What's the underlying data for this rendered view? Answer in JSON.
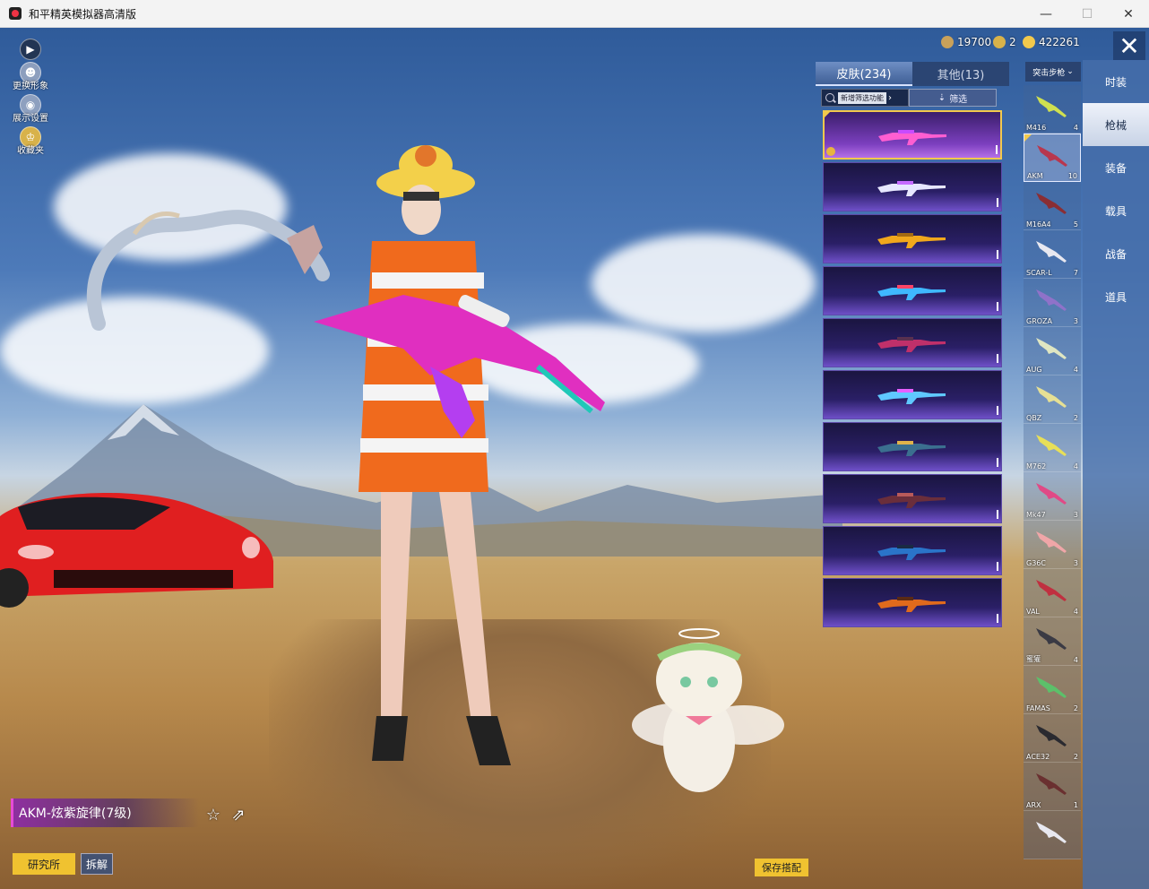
{
  "window": {
    "title": "和平精英模拟器高清版",
    "minimize": "—",
    "maximize": "☐",
    "close": "✕"
  },
  "left_controls": [
    {
      "label": ""
    },
    {
      "label": "更换形象"
    },
    {
      "label": "展示设置"
    },
    {
      "label": "收藏夹"
    }
  ],
  "currency": [
    {
      "value": "19700",
      "color": "#c9a15a"
    },
    {
      "value": "2",
      "color": "#d8b24a"
    },
    {
      "value": "422261",
      "color": "#f2c94c"
    }
  ],
  "panel": {
    "tabs": [
      {
        "label": "皮肤(234)",
        "active": true
      },
      {
        "label": "其他(13)",
        "active": false
      }
    ],
    "filter_tag": "新增筛选功能",
    "filter_button": "筛选",
    "weapon_type": "突击步枪"
  },
  "skins": [
    {
      "colors": [
        "#ff5ed1",
        "#c84bff"
      ],
      "selected": true
    },
    {
      "colors": [
        "#e7e7ff",
        "#c66bff"
      ],
      "selected": false
    },
    {
      "colors": [
        "#f1a81c",
        "#a46a12"
      ],
      "selected": false
    },
    {
      "colors": [
        "#3fb8ff",
        "#ff4466"
      ],
      "selected": false
    },
    {
      "colors": [
        "#c0306a",
        "#59304f"
      ],
      "selected": false
    },
    {
      "colors": [
        "#5fc8ff",
        "#e65fff"
      ],
      "selected": false
    },
    {
      "colors": [
        "#3b6f8f",
        "#e0b34a"
      ],
      "selected": false
    },
    {
      "colors": [
        "#6a2e3b",
        "#b85a5a"
      ],
      "selected": false
    },
    {
      "colors": [
        "#2a74c9",
        "#1a2a44"
      ],
      "selected": false
    },
    {
      "colors": [
        "#e06a1c",
        "#5a2a14"
      ],
      "selected": false
    }
  ],
  "weapons": [
    {
      "name": "M416",
      "count": "4",
      "color": "#cfe050",
      "selected": false
    },
    {
      "name": "AKM",
      "count": "10",
      "color": "#b8374e",
      "selected": true
    },
    {
      "name": "M16A4",
      "count": "5",
      "color": "#8a2e34",
      "selected": false
    },
    {
      "name": "SCAR-L",
      "count": "7",
      "color": "#e8e8f0",
      "selected": false
    },
    {
      "name": "GROZA",
      "count": "3",
      "color": "#8f72c9",
      "selected": false
    },
    {
      "name": "AUG",
      "count": "4",
      "color": "#dfe6c2",
      "selected": false
    },
    {
      "name": "QBZ",
      "count": "2",
      "color": "#e6e094",
      "selected": false
    },
    {
      "name": "M762",
      "count": "4",
      "color": "#e8df58",
      "selected": false
    },
    {
      "name": "Mk47",
      "count": "3",
      "color": "#e04a86",
      "selected": false
    },
    {
      "name": "G36C",
      "count": "3",
      "color": "#f0a6a8",
      "selected": false
    },
    {
      "name": "VAL",
      "count": "4",
      "color": "#c03040",
      "selected": false
    },
    {
      "name": "蜜獾",
      "count": "4",
      "color": "#3a3a44",
      "selected": false
    },
    {
      "name": "FAMAS",
      "count": "2",
      "color": "#5cc06a",
      "selected": false
    },
    {
      "name": "ACE32",
      "count": "2",
      "color": "#2a2a30",
      "selected": false
    },
    {
      "name": "ARX",
      "count": "1",
      "color": "#6a3030",
      "selected": false
    },
    {
      "name": "",
      "count": "",
      "color": "#e8e8f0",
      "selected": false
    }
  ],
  "categories": [
    {
      "label": "时装",
      "active": false
    },
    {
      "label": "枪械",
      "active": true
    },
    {
      "label": "装备",
      "active": false
    },
    {
      "label": "载具",
      "active": false
    },
    {
      "label": "战备",
      "active": false
    },
    {
      "label": "道具",
      "active": false
    }
  ],
  "selected_skin_name": "AKM-炫紫旋律(7级)",
  "buttons": {
    "research": "研究所",
    "dismantle": "拆解",
    "save": "保存搭配"
  }
}
